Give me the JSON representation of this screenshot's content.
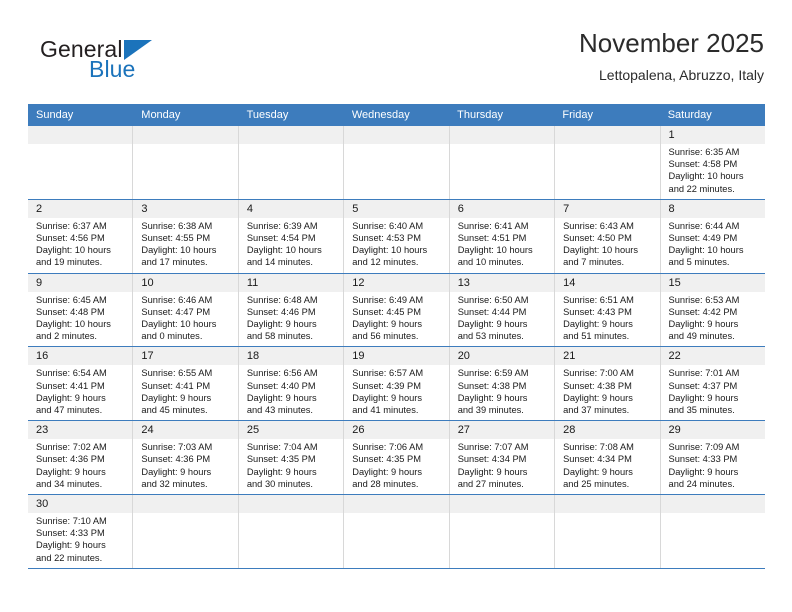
{
  "brand": {
    "name_part1": "General",
    "name_part2": "Blue",
    "flag_icon": "blue-triangle-flag"
  },
  "header": {
    "title": "November 2025",
    "subtitle": "Lettopalena, Abruzzo, Italy"
  },
  "colors": {
    "header_blue": "#3d7cbd",
    "brand_blue": "#1b73bb",
    "day_number_band": "#f0f0f0",
    "cell_border": "#d8d8d8",
    "text": "#1a1a1a"
  },
  "weekdays": [
    "Sunday",
    "Monday",
    "Tuesday",
    "Wednesday",
    "Thursday",
    "Friday",
    "Saturday"
  ],
  "labels": {
    "sunrise": "Sunrise:",
    "sunset": "Sunset:",
    "daylight": "Daylight:"
  },
  "weeks": [
    [
      {
        "day": "",
        "empty": true
      },
      {
        "day": "",
        "empty": true
      },
      {
        "day": "",
        "empty": true
      },
      {
        "day": "",
        "empty": true
      },
      {
        "day": "",
        "empty": true
      },
      {
        "day": "",
        "empty": true
      },
      {
        "day": "1",
        "sunrise": "Sunrise: 6:35 AM",
        "sunset": "Sunset: 4:58 PM",
        "daylight_1": "Daylight: 10 hours",
        "daylight_2": "and 22 minutes."
      }
    ],
    [
      {
        "day": "2",
        "sunrise": "Sunrise: 6:37 AM",
        "sunset": "Sunset: 4:56 PM",
        "daylight_1": "Daylight: 10 hours",
        "daylight_2": "and 19 minutes."
      },
      {
        "day": "3",
        "sunrise": "Sunrise: 6:38 AM",
        "sunset": "Sunset: 4:55 PM",
        "daylight_1": "Daylight: 10 hours",
        "daylight_2": "and 17 minutes."
      },
      {
        "day": "4",
        "sunrise": "Sunrise: 6:39 AM",
        "sunset": "Sunset: 4:54 PM",
        "daylight_1": "Daylight: 10 hours",
        "daylight_2": "and 14 minutes."
      },
      {
        "day": "5",
        "sunrise": "Sunrise: 6:40 AM",
        "sunset": "Sunset: 4:53 PM",
        "daylight_1": "Daylight: 10 hours",
        "daylight_2": "and 12 minutes."
      },
      {
        "day": "6",
        "sunrise": "Sunrise: 6:41 AM",
        "sunset": "Sunset: 4:51 PM",
        "daylight_1": "Daylight: 10 hours",
        "daylight_2": "and 10 minutes."
      },
      {
        "day": "7",
        "sunrise": "Sunrise: 6:43 AM",
        "sunset": "Sunset: 4:50 PM",
        "daylight_1": "Daylight: 10 hours",
        "daylight_2": "and 7 minutes."
      },
      {
        "day": "8",
        "sunrise": "Sunrise: 6:44 AM",
        "sunset": "Sunset: 4:49 PM",
        "daylight_1": "Daylight: 10 hours",
        "daylight_2": "and 5 minutes."
      }
    ],
    [
      {
        "day": "9",
        "sunrise": "Sunrise: 6:45 AM",
        "sunset": "Sunset: 4:48 PM",
        "daylight_1": "Daylight: 10 hours",
        "daylight_2": "and 2 minutes."
      },
      {
        "day": "10",
        "sunrise": "Sunrise: 6:46 AM",
        "sunset": "Sunset: 4:47 PM",
        "daylight_1": "Daylight: 10 hours",
        "daylight_2": "and 0 minutes."
      },
      {
        "day": "11",
        "sunrise": "Sunrise: 6:48 AM",
        "sunset": "Sunset: 4:46 PM",
        "daylight_1": "Daylight: 9 hours",
        "daylight_2": "and 58 minutes."
      },
      {
        "day": "12",
        "sunrise": "Sunrise: 6:49 AM",
        "sunset": "Sunset: 4:45 PM",
        "daylight_1": "Daylight: 9 hours",
        "daylight_2": "and 56 minutes."
      },
      {
        "day": "13",
        "sunrise": "Sunrise: 6:50 AM",
        "sunset": "Sunset: 4:44 PM",
        "daylight_1": "Daylight: 9 hours",
        "daylight_2": "and 53 minutes."
      },
      {
        "day": "14",
        "sunrise": "Sunrise: 6:51 AM",
        "sunset": "Sunset: 4:43 PM",
        "daylight_1": "Daylight: 9 hours",
        "daylight_2": "and 51 minutes."
      },
      {
        "day": "15",
        "sunrise": "Sunrise: 6:53 AM",
        "sunset": "Sunset: 4:42 PM",
        "daylight_1": "Daylight: 9 hours",
        "daylight_2": "and 49 minutes."
      }
    ],
    [
      {
        "day": "16",
        "sunrise": "Sunrise: 6:54 AM",
        "sunset": "Sunset: 4:41 PM",
        "daylight_1": "Daylight: 9 hours",
        "daylight_2": "and 47 minutes."
      },
      {
        "day": "17",
        "sunrise": "Sunrise: 6:55 AM",
        "sunset": "Sunset: 4:41 PM",
        "daylight_1": "Daylight: 9 hours",
        "daylight_2": "and 45 minutes."
      },
      {
        "day": "18",
        "sunrise": "Sunrise: 6:56 AM",
        "sunset": "Sunset: 4:40 PM",
        "daylight_1": "Daylight: 9 hours",
        "daylight_2": "and 43 minutes."
      },
      {
        "day": "19",
        "sunrise": "Sunrise: 6:57 AM",
        "sunset": "Sunset: 4:39 PM",
        "daylight_1": "Daylight: 9 hours",
        "daylight_2": "and 41 minutes."
      },
      {
        "day": "20",
        "sunrise": "Sunrise: 6:59 AM",
        "sunset": "Sunset: 4:38 PM",
        "daylight_1": "Daylight: 9 hours",
        "daylight_2": "and 39 minutes."
      },
      {
        "day": "21",
        "sunrise": "Sunrise: 7:00 AM",
        "sunset": "Sunset: 4:38 PM",
        "daylight_1": "Daylight: 9 hours",
        "daylight_2": "and 37 minutes."
      },
      {
        "day": "22",
        "sunrise": "Sunrise: 7:01 AM",
        "sunset": "Sunset: 4:37 PM",
        "daylight_1": "Daylight: 9 hours",
        "daylight_2": "and 35 minutes."
      }
    ],
    [
      {
        "day": "23",
        "sunrise": "Sunrise: 7:02 AM",
        "sunset": "Sunset: 4:36 PM",
        "daylight_1": "Daylight: 9 hours",
        "daylight_2": "and 34 minutes."
      },
      {
        "day": "24",
        "sunrise": "Sunrise: 7:03 AM",
        "sunset": "Sunset: 4:36 PM",
        "daylight_1": "Daylight: 9 hours",
        "daylight_2": "and 32 minutes."
      },
      {
        "day": "25",
        "sunrise": "Sunrise: 7:04 AM",
        "sunset": "Sunset: 4:35 PM",
        "daylight_1": "Daylight: 9 hours",
        "daylight_2": "and 30 minutes."
      },
      {
        "day": "26",
        "sunrise": "Sunrise: 7:06 AM",
        "sunset": "Sunset: 4:35 PM",
        "daylight_1": "Daylight: 9 hours",
        "daylight_2": "and 28 minutes."
      },
      {
        "day": "27",
        "sunrise": "Sunrise: 7:07 AM",
        "sunset": "Sunset: 4:34 PM",
        "daylight_1": "Daylight: 9 hours",
        "daylight_2": "and 27 minutes."
      },
      {
        "day": "28",
        "sunrise": "Sunrise: 7:08 AM",
        "sunset": "Sunset: 4:34 PM",
        "daylight_1": "Daylight: 9 hours",
        "daylight_2": "and 25 minutes."
      },
      {
        "day": "29",
        "sunrise": "Sunrise: 7:09 AM",
        "sunset": "Sunset: 4:33 PM",
        "daylight_1": "Daylight: 9 hours",
        "daylight_2": "and 24 minutes."
      }
    ],
    [
      {
        "day": "30",
        "sunrise": "Sunrise: 7:10 AM",
        "sunset": "Sunset: 4:33 PM",
        "daylight_1": "Daylight: 9 hours",
        "daylight_2": "and 22 minutes."
      },
      {
        "day": "",
        "empty": true
      },
      {
        "day": "",
        "empty": true
      },
      {
        "day": "",
        "empty": true
      },
      {
        "day": "",
        "empty": true
      },
      {
        "day": "",
        "empty": true
      },
      {
        "day": "",
        "empty": true
      }
    ]
  ]
}
